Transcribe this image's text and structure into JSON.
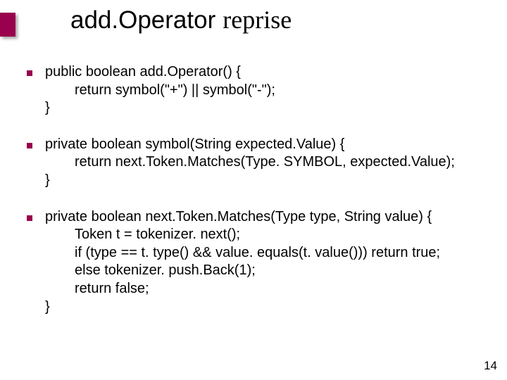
{
  "title": {
    "part1": "add.Operator",
    "part2": "reprise"
  },
  "blocks": [
    {
      "sig": "public boolean add.Operator() {",
      "body": [
        "return symbol(\"+\") || symbol(\"-\");"
      ],
      "close": "}"
    },
    {
      "sig": "private boolean symbol(String expected.Value) {",
      "body": [
        "return next.Token.Matches(Type. SYMBOL, expected.Value);"
      ],
      "close": "}"
    },
    {
      "sig": "private boolean next.Token.Matches(Type type, String value) {",
      "body": [
        "Token t = tokenizer. next();",
        "if (type == t. type() && value. equals(t. value())) return true;",
        "else tokenizer. push.Back(1);",
        "return false;"
      ],
      "close": "}"
    }
  ],
  "pagenum": "14"
}
